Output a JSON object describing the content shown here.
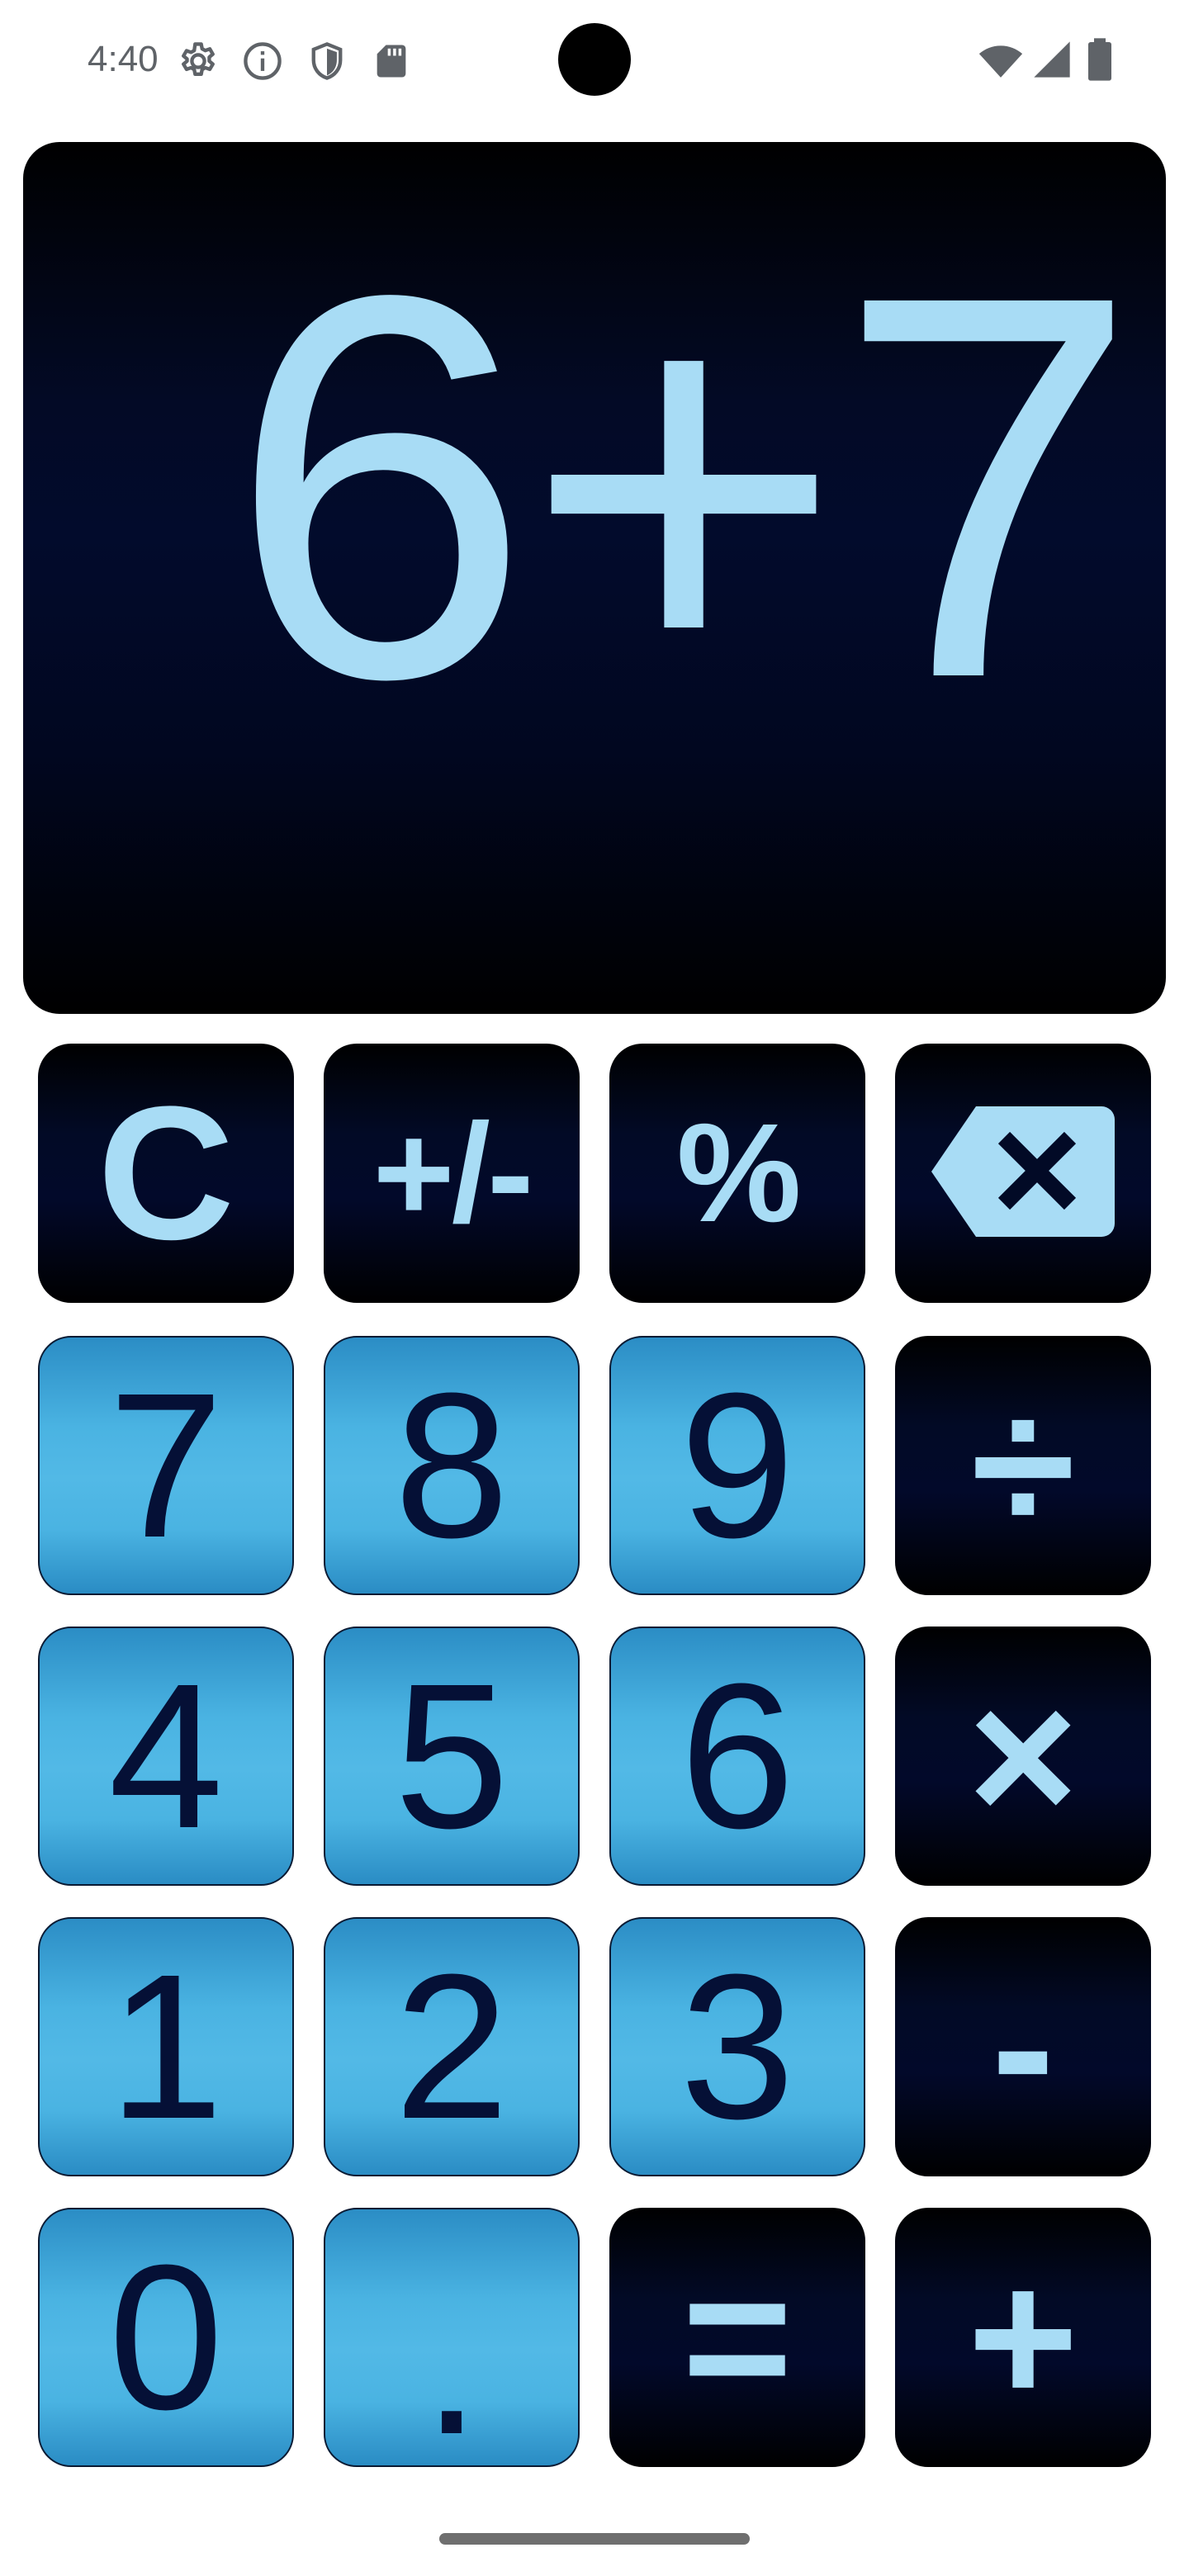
{
  "status_bar": {
    "time": "4:40",
    "left_icons": [
      "settings-icon",
      "info-icon",
      "shield-icon",
      "sd-card-icon"
    ],
    "right_icons": [
      "wifi-icon",
      "cell-signal-icon",
      "battery-icon"
    ]
  },
  "display": {
    "expression": "6+7"
  },
  "keys": {
    "clear": "C",
    "plus_minus": "+/-",
    "percent": "%",
    "backspace_icon": "backspace-icon",
    "seven": "7",
    "eight": "8",
    "nine": "9",
    "divide": "÷",
    "four": "4",
    "five": "5",
    "six": "6",
    "multiply": "×",
    "one": "1",
    "two": "2",
    "three": "3",
    "minus": "-",
    "zero": "0",
    "decimal": ".",
    "equals": "=",
    "plus": "+"
  },
  "colors": {
    "display_text": "#a8dcf5",
    "light_key": "#4ab3e2",
    "dark_key": "#020a26",
    "light_key_text": "#051036"
  }
}
